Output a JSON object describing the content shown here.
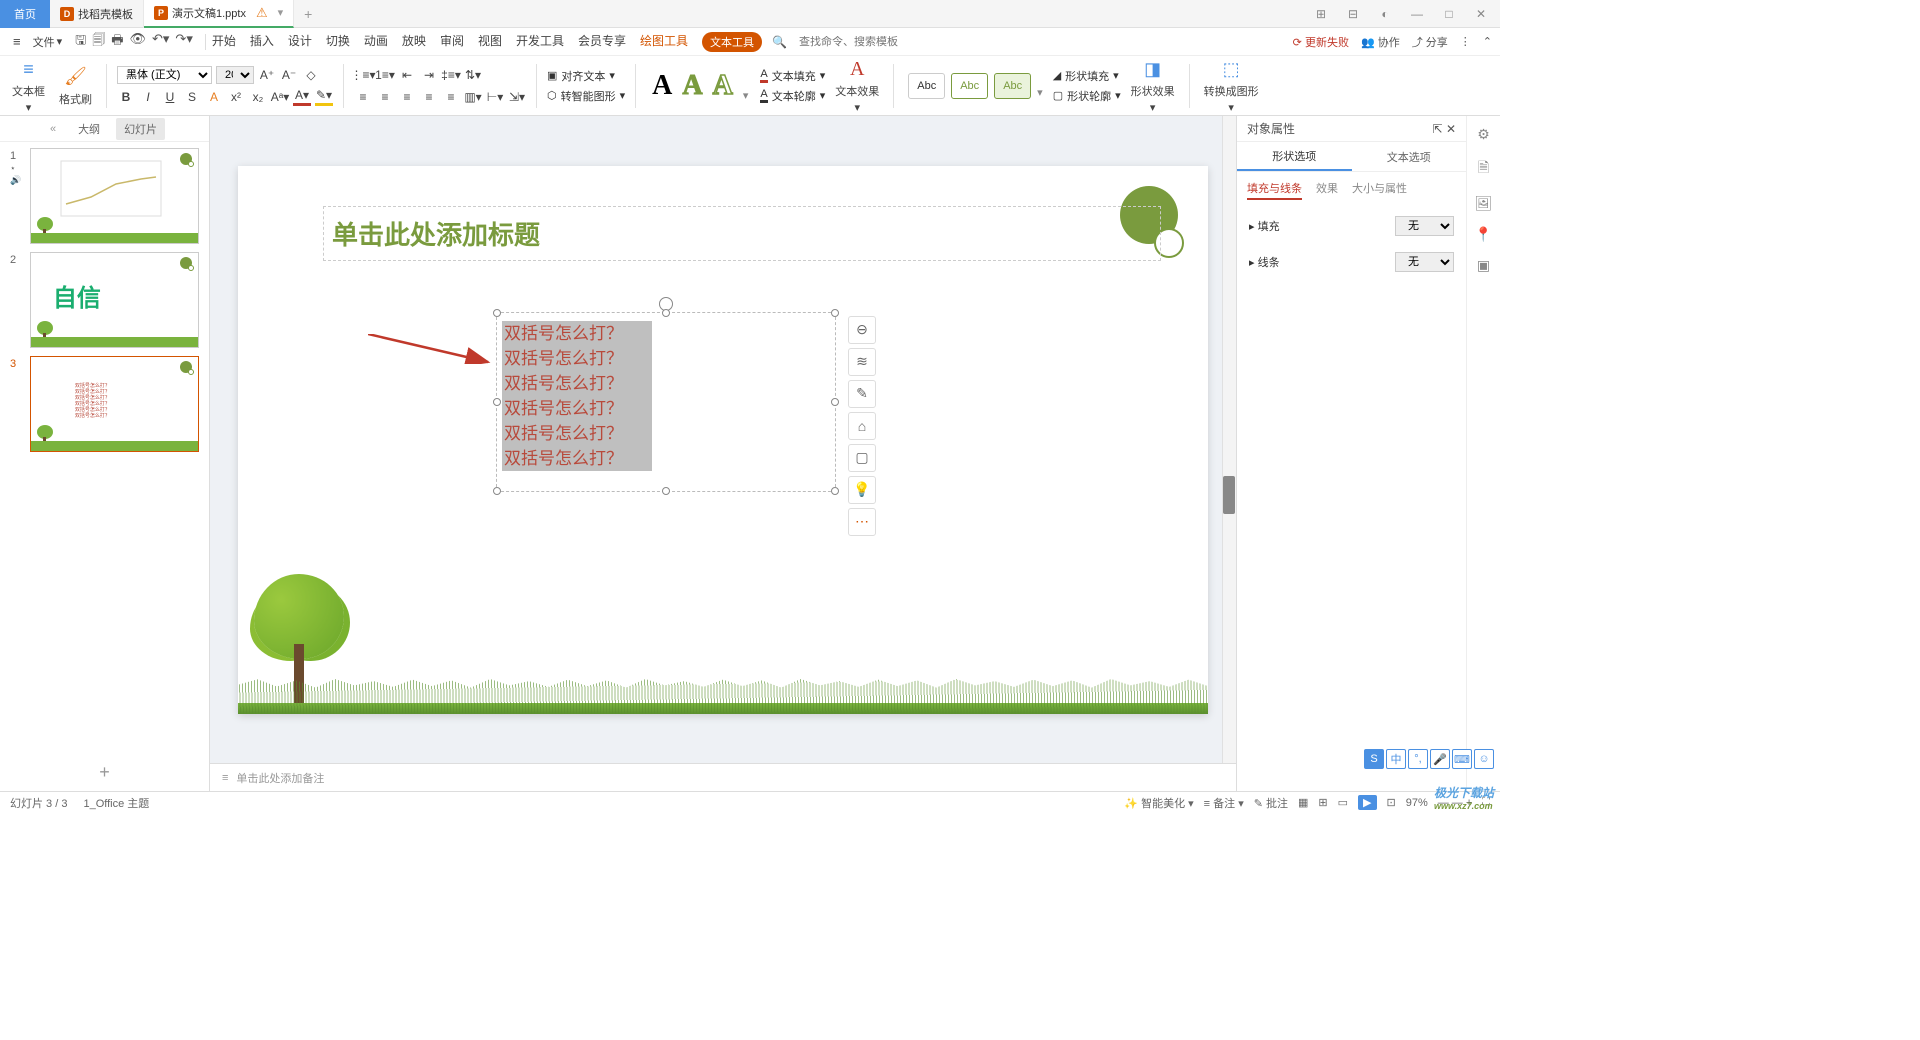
{
  "titlebar": {
    "home": "首页",
    "tab1": "找稻壳模板",
    "tab2": "演示文稿1.pptx"
  },
  "menu": {
    "file": "文件",
    "tabs": [
      "开始",
      "插入",
      "设计",
      "切换",
      "动画",
      "放映",
      "审阅",
      "视图",
      "开发工具",
      "会员专享"
    ],
    "draw_tool": "绘图工具",
    "text_tool": "文本工具",
    "search_ph": "查找命令、搜索模板",
    "update_fail": "更新失败",
    "coop": "协作",
    "share": "分享"
  },
  "ribbon": {
    "textbox": "文本框",
    "format_painter": "格式刷",
    "font_name": "黑体 (正文)",
    "font_size": "20",
    "align_text": "对齐文本",
    "smart_gfx": "转智能图形",
    "text_fill": "文本填充",
    "text_outline": "文本轮廓",
    "text_effect": "文本效果",
    "preset": "Abc",
    "shape_fill": "形状填充",
    "shape_outline": "形状轮廓",
    "shape_effect": "形状效果",
    "to_image": "转换成图形"
  },
  "leftpanel": {
    "outline": "大纲",
    "slides": "幻灯片",
    "thumb2_text": "自信",
    "thumb3_lines": [
      "双括号怎么打？",
      "双括号怎么打？",
      "双括号怎么打？",
      "双括号怎么打？",
      "双括号怎么打？",
      "双括号怎么打？"
    ]
  },
  "slide": {
    "title_ph": "单击此处添加标题",
    "text_lines": [
      "双括号怎么打？",
      "双括号怎么打？",
      "双括号怎么打？",
      "双括号怎么打？",
      "双括号怎么打？",
      "双括号怎么打？"
    ]
  },
  "notes": {
    "ph": "单击此处添加备注"
  },
  "rightpanel": {
    "title": "对象属性",
    "tab_shape": "形状选项",
    "tab_text": "文本选项",
    "sub_fill": "填充与线条",
    "sub_effect": "效果",
    "sub_size": "大小与属性",
    "sec_fill": "填充",
    "sec_line": "线条",
    "none": "无"
  },
  "status": {
    "slide_idx": "幻灯片 3 / 3",
    "theme": "1_Office 主题",
    "beautify": "智能美化",
    "notes_btn": "备注",
    "comment": "批注",
    "zoom": "97%"
  },
  "logo": {
    "brand": "极光下载站",
    "url": "www.xz7.com"
  }
}
